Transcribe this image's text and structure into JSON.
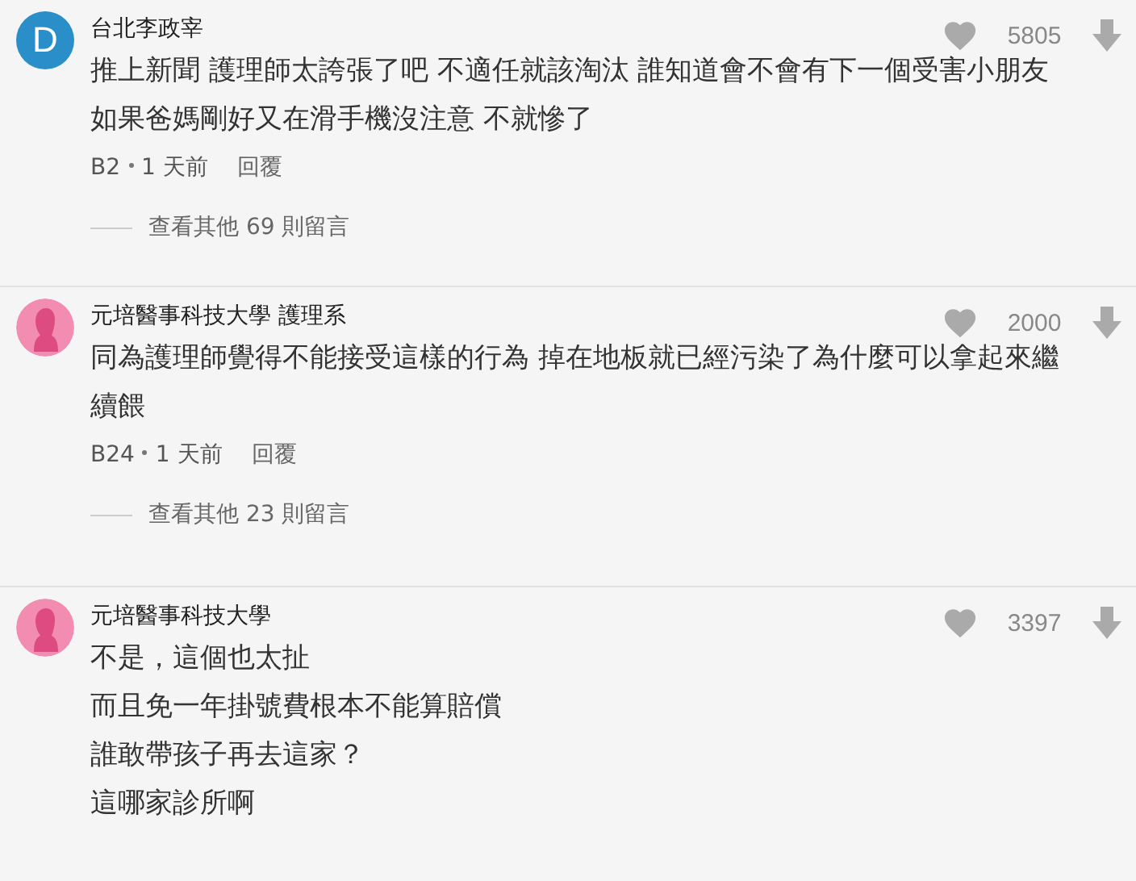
{
  "comments": [
    {
      "avatar": {
        "kind": "letter",
        "letter": "D",
        "color": "#2a8fc9"
      },
      "author": "台北李政宰",
      "likes": "5805",
      "lines": [
        "推上新聞 護理師太誇張了吧 不適任就該淘汰 誰知道會不會有下一個受害小朋友",
        "如果爸媽剛好又在滑手機沒注意 不就慘了"
      ],
      "floor": "B2",
      "time": "1 天前",
      "reply": "回覆",
      "more": "查看其他 69 則留言"
    },
    {
      "avatar": {
        "kind": "silhouette",
        "color": "#f28cb1"
      },
      "author": "元培醫事科技大學 護理系",
      "likes": "2000",
      "lines": [
        "同為護理師覺得不能接受這樣的行為 掉在地板就已經污染了為什麼可以拿起來繼",
        "續餵"
      ],
      "floor": "B24",
      "time": "1 天前",
      "reply": "回覆",
      "more": "查看其他 23 則留言"
    },
    {
      "avatar": {
        "kind": "silhouette",
        "color": "#f28cb1"
      },
      "author": "元培醫事科技大學",
      "likes": "3397",
      "lines": [
        "不是，這個也太扯",
        "而且免一年掛號費根本不能算賠償",
        "誰敢帶孩子再去這家？",
        "這哪家診所啊"
      ]
    }
  ]
}
